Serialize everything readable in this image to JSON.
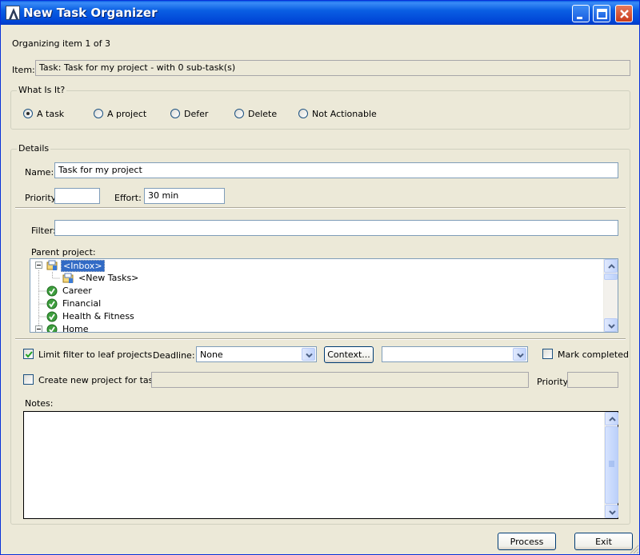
{
  "window": {
    "title": "New Task Organizer"
  },
  "progress_text": "Organizing item 1 of 3",
  "item": {
    "label": "Item:",
    "value": "Task: Task for my project - with 0 sub-task(s)"
  },
  "what_is_it": {
    "legend": "What Is It?",
    "options": [
      {
        "label": "A task",
        "checked": true
      },
      {
        "label": "A project",
        "checked": false
      },
      {
        "label": "Defer",
        "checked": false
      },
      {
        "label": "Delete",
        "checked": false
      },
      {
        "label": "Not Actionable",
        "checked": false
      }
    ]
  },
  "details": {
    "legend": "Details",
    "name_label": "Name:",
    "name_value": "Task for my project",
    "priority_label": "Priority:",
    "priority_value": "",
    "effort_label": "Effort:",
    "effort_value": "30 min",
    "filter_label": "Filter:",
    "filter_value": "",
    "parent_project_label": "Parent project:",
    "tree": [
      {
        "label": "<Inbox>",
        "icon": "inbox-icon",
        "selected": true,
        "expanded": true
      },
      {
        "label": "<New Tasks>",
        "icon": "new-tasks-icon",
        "selected": false
      },
      {
        "label": "Career",
        "icon": "check-circle-icon",
        "selected": false
      },
      {
        "label": "Financial",
        "icon": "check-circle-icon",
        "selected": false
      },
      {
        "label": "Health & Fitness",
        "icon": "check-circle-icon",
        "selected": false
      },
      {
        "label": "Home",
        "icon": "check-circle-icon",
        "selected": false,
        "expanded": true
      }
    ],
    "limit_filter_label": "Limit filter to leaf projects",
    "limit_filter_checked": true,
    "deadline_label": "Deadline:",
    "deadline_value": "None",
    "context_button": "Context...",
    "context_value": "",
    "mark_completed_label": "Mark completed",
    "mark_completed_checked": false,
    "create_project_label": "Create new project for task",
    "create_project_checked": false,
    "create_project_value": "",
    "priority2_label": "Priority:",
    "priority2_value": "",
    "notes_label": "Notes:",
    "notes_value": ""
  },
  "footer": {
    "process_button": "Process",
    "exit_button": "Exit"
  },
  "colors": {
    "titlebar": "#0A5FE3",
    "face": "#ECE9D8",
    "selection": "#316AC5"
  }
}
